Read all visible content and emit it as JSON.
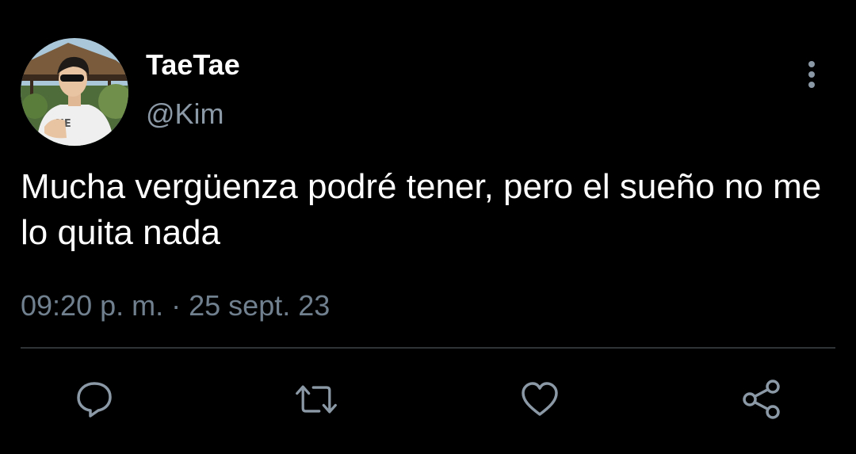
{
  "tweet": {
    "author": {
      "display_name": "TaeTae",
      "handle": "@Kim",
      "avatar_shirt_text": "NE"
    },
    "text": "Mucha vergüenza podré tener, pero el sueño no me lo quita nada",
    "time": "09:20 p. m.",
    "separator": "·",
    "date": "25 sept. 23"
  },
  "actions": {
    "reply_icon": "reply-icon",
    "retweet_icon": "retweet-icon",
    "like_icon": "heart-icon",
    "share_icon": "share-icon"
  },
  "menu": {
    "icon": "more-vertical-icon"
  },
  "colors": {
    "background": "#000000",
    "primary_text": "#ffffff",
    "secondary_text": "#8b98a5",
    "icon": "#8b98a5",
    "divider": "#2f3336"
  }
}
